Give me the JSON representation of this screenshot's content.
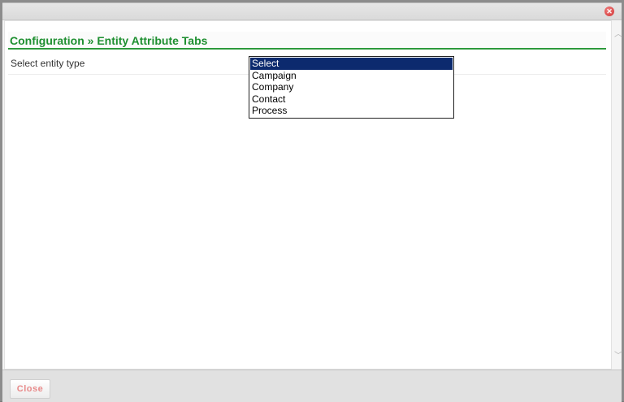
{
  "header": {
    "title": "Configuration » Entity Attribute Tabs"
  },
  "form": {
    "label": "Select entity type",
    "entity_options": [
      "Select",
      "Campaign",
      "Company",
      "Contact",
      "Process"
    ],
    "selected_option": "Select"
  },
  "footer": {
    "close_label": "Close"
  },
  "icons": {
    "dialog_close": "close-circle-icon",
    "scroll_up": "chevron-up-icon",
    "scroll_down": "chevron-down-icon"
  },
  "colors": {
    "title_green": "#1e8f30",
    "divider_green": "#2e9a3c",
    "selection_bg": "#0c2a6e",
    "close_button_text": "#e88a8a",
    "close_icon_red": "#d03030"
  }
}
